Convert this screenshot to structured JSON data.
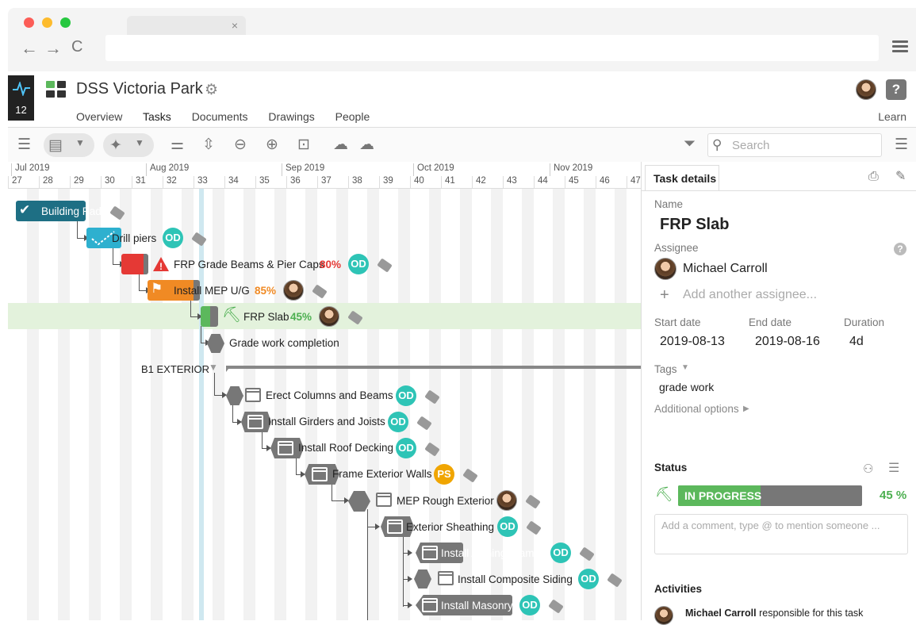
{
  "browser": {
    "tab_close": "×",
    "back": "←",
    "forward": "→",
    "reload": "C"
  },
  "app": {
    "notification_count": "12",
    "project_title": "DSS Victoria Park",
    "learn": "Learn",
    "help": "?"
  },
  "nav_tabs": [
    {
      "label": "Overview"
    },
    {
      "label": "Tasks"
    },
    {
      "label": "Documents"
    },
    {
      "label": "Drawings"
    },
    {
      "label": "People"
    }
  ],
  "search": {
    "placeholder": "Search"
  },
  "timeline": {
    "months": [
      "Jul 2019",
      "Aug 2019",
      "Sep 2019",
      "Oct 2019",
      "Nov 2019"
    ],
    "weeks": [
      "27",
      "28",
      "29",
      "30",
      "31",
      "32",
      "33",
      "34",
      "35",
      "36",
      "37",
      "38",
      "39",
      "40",
      "41",
      "42",
      "43",
      "44",
      "45",
      "46",
      "47"
    ]
  },
  "tasks": {
    "t1": {
      "name": "Building Pad"
    },
    "t2": {
      "name": "Drill piers",
      "badge": "OD"
    },
    "t3": {
      "name": "FRP Grade Beams & Pier Caps",
      "pct": "80%",
      "badge": "OD",
      "pct_color": "#e53935"
    },
    "t4": {
      "name": "Install MEP  U/G",
      "pct": "85%",
      "pct_color": "#f08a24"
    },
    "t5": {
      "name": "FRP Slab",
      "pct": "45%",
      "pct_color": "#4caf50"
    },
    "t6": {
      "name": "Grade work completion"
    },
    "group": {
      "name": "B1 EXTERIOR"
    },
    "t7": {
      "name": "Erect Columns and Beams",
      "badge": "OD"
    },
    "t8": {
      "name": "Install Girders and Joists",
      "badge": "OD"
    },
    "t9": {
      "name": "Install Roof Decking",
      "badge": "OD"
    },
    "t10": {
      "name": "Frame Exterior Walls",
      "badge": "PS"
    },
    "t11": {
      "name": "MEP Rough Exterior"
    },
    "t12": {
      "name": "Exterior Sheathing",
      "badge": "OD"
    },
    "t13": {
      "name": "Install Awning Frames",
      "badge": "OD"
    },
    "t14": {
      "name": "Install Composite Siding",
      "badge": "OD"
    },
    "t15": {
      "name": "Install Masonry",
      "badge": "OD"
    }
  },
  "details": {
    "tab": "Task details",
    "name_label": "Name",
    "name": "FRP Slab",
    "assignee_label": "Assignee",
    "assignee": "Michael Carroll",
    "add_assignee": "Add another assignee...",
    "start_label": "Start date",
    "start": "2019-08-13",
    "end_label": "End date",
    "end": "2019-08-16",
    "duration_label": "Duration",
    "duration": "4d",
    "tags_label": "Tags",
    "tag": "grade work",
    "additional": "Additional options",
    "status_label": "Status",
    "status": "IN PROGRESS",
    "progress_pct": "45 %",
    "progress_fraction": 0.45,
    "comment_placeholder": "Add a comment, type @ to mention someone ...",
    "activities_label": "Activities",
    "activity_user": "Michael Carroll",
    "activity_text": " responsible for this task"
  },
  "colors": {
    "accent": "#2aa3b4",
    "complete": "#1e6f84",
    "drill": "#2eb0cf",
    "red": "#e53935",
    "orange": "#f08a24",
    "green": "#5cb85c",
    "od": "#2ec4b6",
    "ps": "#f0a500",
    "gray": "#777777"
  }
}
